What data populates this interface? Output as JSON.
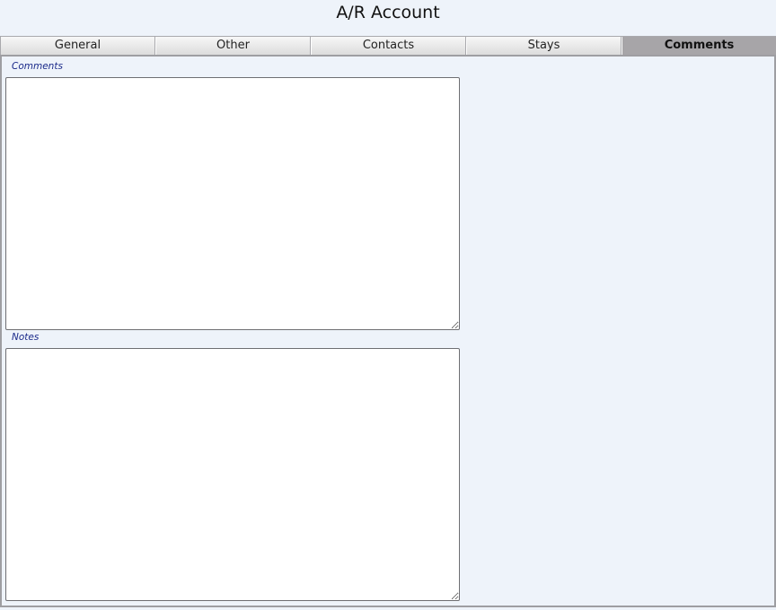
{
  "window": {
    "title": "A/R Account"
  },
  "tabs": [
    {
      "label": "General",
      "active": false
    },
    {
      "label": "Other",
      "active": false
    },
    {
      "label": "Contacts",
      "active": false
    },
    {
      "label": "Stays",
      "active": false
    },
    {
      "label": "Comments",
      "active": true
    }
  ],
  "form": {
    "comments": {
      "label": "Comments",
      "value": ""
    },
    "notes": {
      "label": "Notes",
      "value": ""
    }
  }
}
